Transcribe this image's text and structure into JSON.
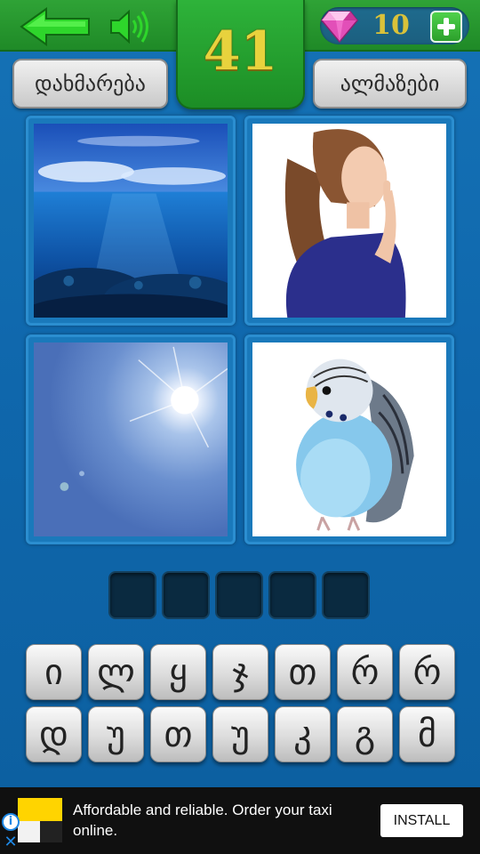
{
  "top_bar": {
    "back_icon": "arrow-left-icon",
    "sound_icon": "speaker-icon",
    "level": "41",
    "gem_icon": "diamond-icon",
    "gem_count": "10",
    "plus_icon": "plus-icon"
  },
  "buttons": {
    "help_label": "დახმარება",
    "gems_label": "ალმაზები"
  },
  "pictures": [
    "ocean",
    "thinking-girl",
    "sun",
    "budgie"
  ],
  "answer": {
    "slot_count": 5,
    "slots": [
      "",
      "",
      "",
      "",
      ""
    ]
  },
  "letters": {
    "row1": [
      "ი",
      "ლ",
      "ყ",
      "ჯ",
      "თ",
      "რ",
      "რ"
    ],
    "row2": [
      "დ",
      "უ",
      "თ",
      "უ",
      "კ",
      "გ",
      "მ"
    ]
  },
  "ad": {
    "text": "Affordable and reliable. Order your taxi online.",
    "install_label": "INSTALL",
    "info_icon": "info-icon",
    "close_icon": "close-icon"
  },
  "colors": {
    "background": "#1572b6",
    "top_bar": "#2fa336",
    "level_number": "#e8d23d",
    "gem_count": "#d9c23a",
    "slot": "#0a2a40",
    "ad_background": "#101010"
  }
}
